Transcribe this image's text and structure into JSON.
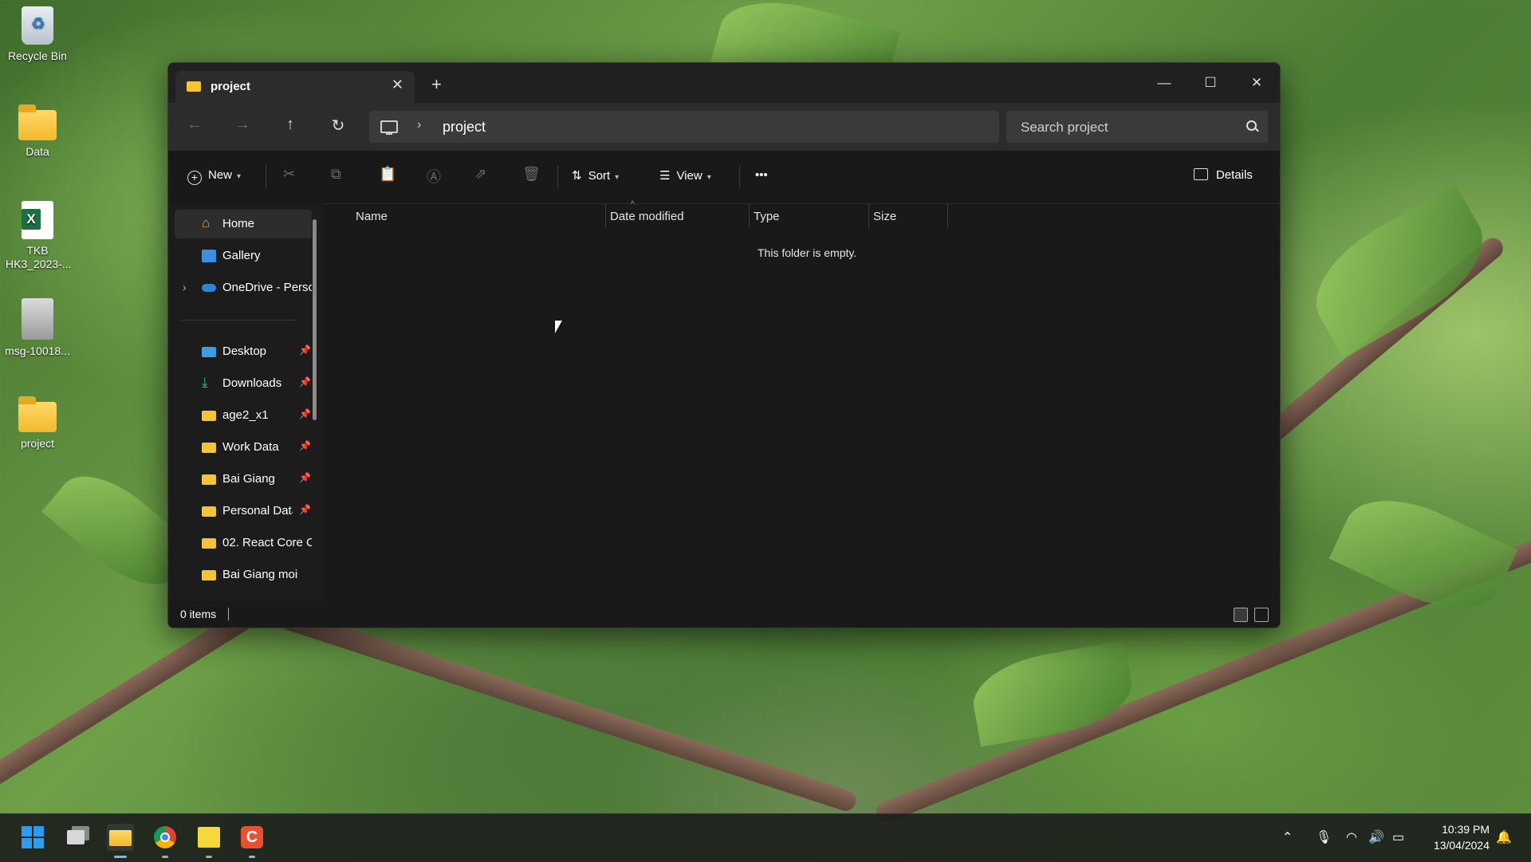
{
  "desktop": {
    "icons": [
      {
        "label": "Recycle Bin",
        "icon": "recycle-bin-icon"
      },
      {
        "label": "Data",
        "icon": "folder-icon"
      },
      {
        "label": "TKB HK3_2023-...",
        "icon": "excel-file-icon"
      },
      {
        "label": "msg-10018...",
        "icon": "image-file-icon"
      },
      {
        "label": "project",
        "icon": "folder-icon"
      }
    ]
  },
  "window": {
    "tab_title": "project",
    "new_tab": "+",
    "address_path": "project",
    "search_placeholder": "Search project",
    "toolbar": {
      "new_label": "New",
      "sort_label": "Sort",
      "view_label": "View",
      "more_label": "•••",
      "details_label": "Details"
    },
    "sidebar": {
      "items": [
        {
          "label": "Home",
          "icon": "home-icon",
          "selected": true
        },
        {
          "label": "Gallery",
          "icon": "gallery-icon"
        },
        {
          "label": "OneDrive - Perso",
          "icon": "onedrive-icon",
          "expandable": true
        },
        {
          "label": "Desktop",
          "icon": "desktop-icon",
          "pinned": true
        },
        {
          "label": "Downloads",
          "icon": "downloads-icon",
          "pinned": true
        },
        {
          "label": "age2_x1",
          "icon": "folder-icon",
          "pinned": true
        },
        {
          "label": "Work Data",
          "icon": "folder-icon",
          "pinned": true
        },
        {
          "label": "Bai Giang",
          "icon": "folder-icon",
          "pinned": true
        },
        {
          "label": "Personal Data",
          "icon": "folder-icon",
          "pinned": true
        },
        {
          "label": "02. React Core C",
          "icon": "folder-icon"
        },
        {
          "label": "Bai Giang moi",
          "icon": "folder-icon"
        }
      ]
    },
    "columns": [
      "Name",
      "Date modified",
      "Type",
      "Size"
    ],
    "empty_message": "This folder is empty.",
    "status": {
      "item_count": "0 items"
    }
  },
  "taskbar": {
    "apps": [
      "start",
      "task-view",
      "file-explorer",
      "chrome",
      "sticky-notes",
      "codex-app"
    ],
    "clock_time": "10:39 PM",
    "clock_date": "13/04/2024"
  },
  "colors": {
    "folder": "#f4c431",
    "window_bg": "#191919",
    "accent": "#0078d4"
  }
}
